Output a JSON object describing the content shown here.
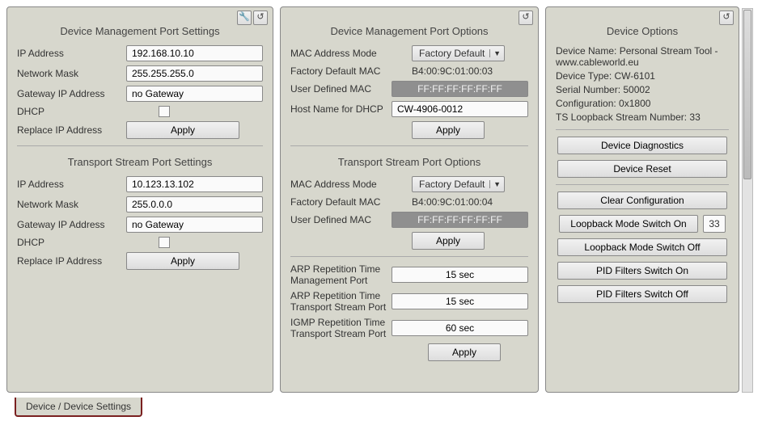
{
  "panel1": {
    "title1": "Device Management Port Settings",
    "ip_label": "IP Address",
    "ip_val": "192.168.10.10",
    "mask_label": "Network Mask",
    "mask_val": "255.255.255.0",
    "gw_label": "Gateway IP Address",
    "gw_val": "no Gateway",
    "dhcp_label": "DHCP",
    "replace_label": "Replace IP Address",
    "apply": "Apply",
    "title2": "Transport Stream Port Settings",
    "ts_ip_val": "10.123.13.102",
    "ts_mask_val": "255.0.0.0",
    "ts_gw_val": "no Gateway"
  },
  "panel2": {
    "title1": "Device Management Port Options",
    "mac_mode_label": "MAC Address Mode",
    "mac_mode_val": "Factory Default",
    "factory_mac_label": "Factory Default MAC",
    "factory_mac_val": "B4:00:9C:01:00:03",
    "user_mac_label": "User Defined MAC",
    "user_mac_val": "FF:FF:FF:FF:FF:FF",
    "host_label": "Host Name for DHCP",
    "host_val": "CW-4906-0012",
    "apply": "Apply",
    "title2": "Transport Stream Port Options",
    "ts_factory_mac_val": "B4:00:9C:01:00:04",
    "arp1_label_a": "ARP Repetition Time",
    "arp1_label_b": "Management Port",
    "arp1_val": "15 sec",
    "arp2_label_a": "ARP Repetition Time",
    "arp2_label_b": "Transport Stream Port",
    "arp2_val": "15 sec",
    "igmp_label_a": "IGMP Repetition Time",
    "igmp_label_b": "Transport Stream Port",
    "igmp_val": "60 sec"
  },
  "panel3": {
    "title": "Device Options",
    "info1": "Device Name: Personal Stream Tool - www.cableworld.eu",
    "info2": "Device Type: CW-6101",
    "info3": "Serial Number: 50002",
    "info4": "Configuration: 0x1800",
    "info5": "TS Loopback Stream Number: 33",
    "btn_diag": "Device Diagnostics",
    "btn_reset": "Device Reset",
    "btn_clear": "Clear Configuration",
    "btn_loop_on": "Loopback Mode Switch On",
    "loop_num": "33",
    "btn_loop_off": "Loopback Mode Switch Off",
    "btn_pid_on": "PID Filters Switch On",
    "btn_pid_off": "PID Filters Switch Off"
  },
  "bottom_tab": "Device / Device Settings"
}
